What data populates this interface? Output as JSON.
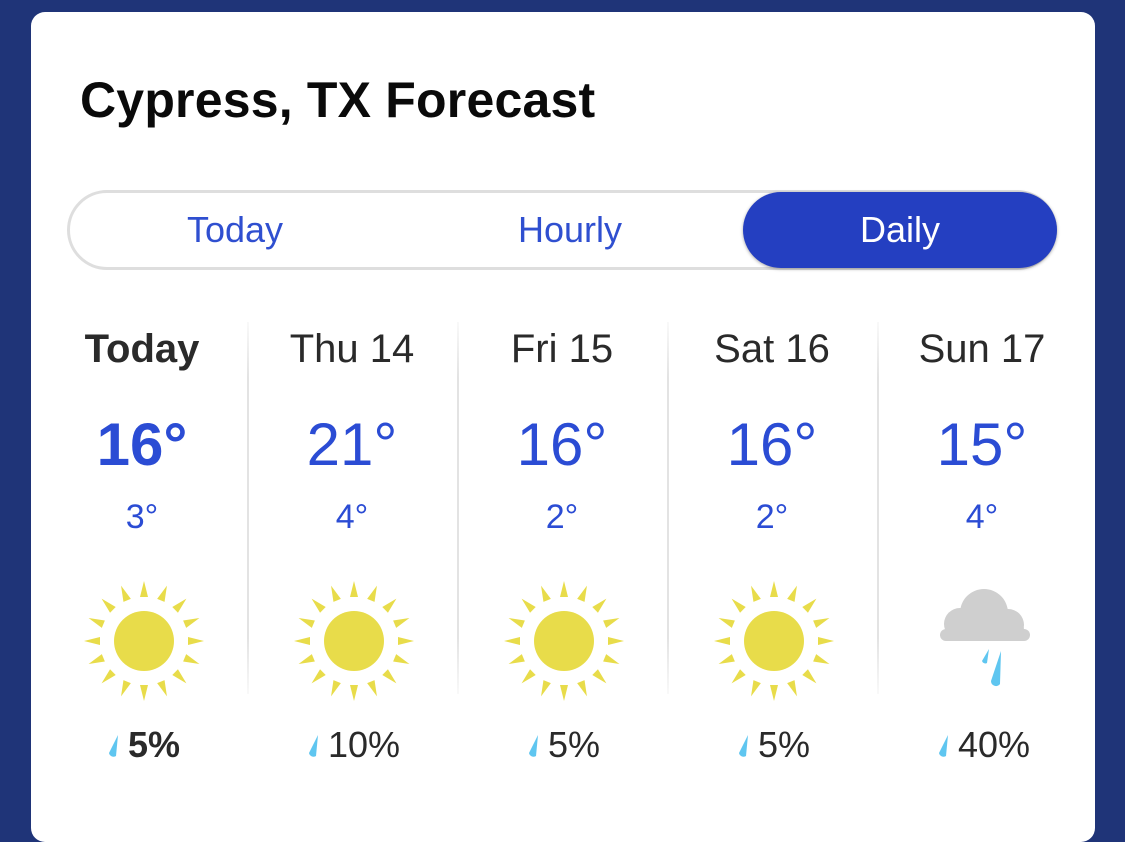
{
  "title": "Cypress, TX Forecast",
  "tabs": [
    {
      "label": "Today"
    },
    {
      "label": "Hourly"
    },
    {
      "label": "Daily"
    }
  ],
  "active_tab": "Daily",
  "colors": {
    "background": "#1f3478",
    "accent": "#243fc1",
    "temp": "#2b4cd4",
    "sun": "#e8dc4a",
    "cloud": "#cfcfcf",
    "rain": "#5fc6f0"
  },
  "days": [
    {
      "name": "Today",
      "high": "16°",
      "low": "3°",
      "icon": "sun-icon",
      "precip": "5%"
    },
    {
      "name": "Thu 14",
      "high": "21°",
      "low": "4°",
      "icon": "sun-icon",
      "precip": "10%"
    },
    {
      "name": "Fri 15",
      "high": "16°",
      "low": "2°",
      "icon": "sun-icon",
      "precip": "5%"
    },
    {
      "name": "Sat 16",
      "high": "16°",
      "low": "2°",
      "icon": "sun-icon",
      "precip": "5%"
    },
    {
      "name": "Sun 17",
      "high": "15°",
      "low": "4°",
      "icon": "rain-cloud-icon",
      "precip": "40%"
    }
  ]
}
